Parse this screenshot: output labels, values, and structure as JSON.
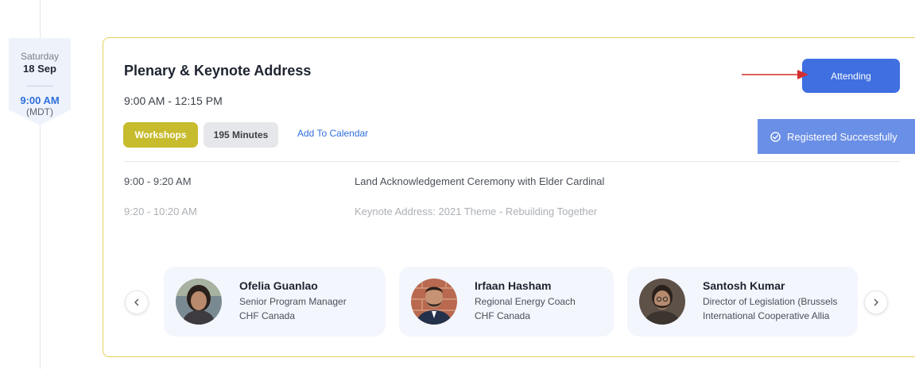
{
  "date_badge": {
    "day_of_week": "Saturday",
    "date": "18 Sep",
    "time": "9:00 AM",
    "timezone": "(MDT)"
  },
  "session": {
    "title": "Plenary & Keynote Address",
    "time_range": "9:00 AM - 12:15 PM",
    "attending_label": "Attending",
    "tags": [
      "Workshops",
      "195 Minutes"
    ],
    "add_to_calendar": "Add To Calendar",
    "registered_label": "Registered Successfully"
  },
  "agenda": [
    {
      "time": "9:00 - 9:20 AM",
      "title": "Land Acknowledgement Ceremony with Elder Cardinal"
    },
    {
      "time": "9:20 - 10:20 AM",
      "title": "Keynote Address: 2021 Theme - Rebuilding Together"
    }
  ],
  "speakers": [
    {
      "name": "Ofelia Guanlao",
      "role": "Senior Program Manager",
      "org": "CHF Canada"
    },
    {
      "name": "Irfaan Hasham",
      "role": "Regional Energy Coach",
      "org": "CHF Canada"
    },
    {
      "name": "Santosh Kumar",
      "role": "Director of Legislation (Brussels",
      "org": "International Cooperative Allia"
    }
  ],
  "colors": {
    "accent": "#3f6fe0",
    "workshop_tag": "#c7bb2e",
    "card_border": "#e3d15a",
    "annotation_arrow": "#d32f2f"
  },
  "icons": {
    "prev": "chevron-left-icon",
    "next": "chevron-right-icon",
    "registered": "check-circle-icon"
  }
}
